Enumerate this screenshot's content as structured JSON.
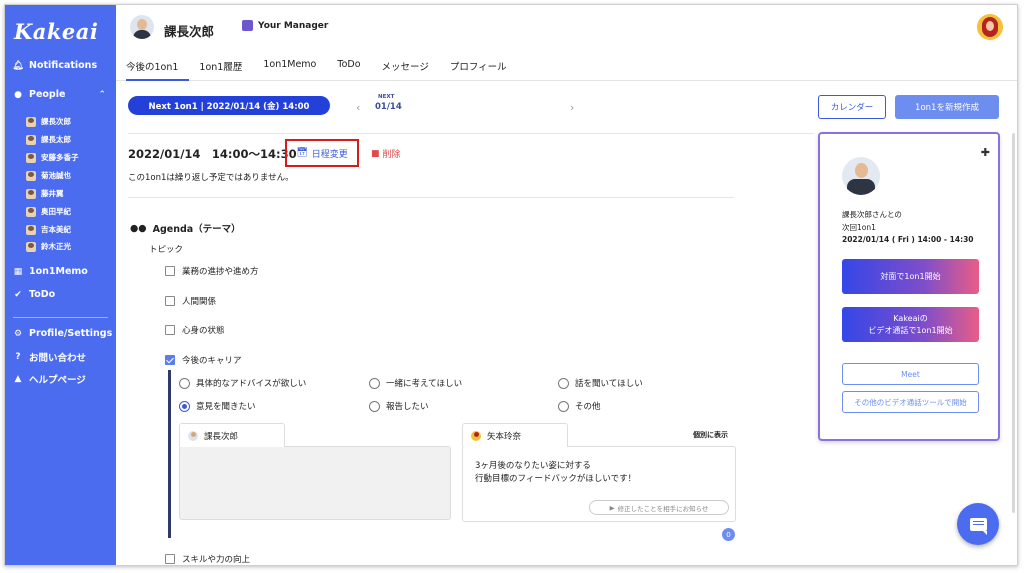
{
  "sidebar": {
    "logo": "Kakeai",
    "nav": {
      "notifications": "Notifications",
      "people": "People",
      "memo": "1on1Memo",
      "todo": "ToDo",
      "profile": "Profile/Settings",
      "contact": "お問い合わせ",
      "help": "ヘルプページ"
    },
    "people": [
      "課長次郎",
      "課長太郎",
      "安藤多香子",
      "菊池誠也",
      "藤井翼",
      "奥田早紀",
      "吉本美紀",
      "鈴木正光"
    ]
  },
  "header": {
    "name": "課長次郎",
    "manager_label": "Your Manager",
    "tabs": [
      "今後の1on1",
      "1on1履歴",
      "1on1Memo",
      "ToDo",
      "メッセージ",
      "プロフィール"
    ]
  },
  "schedule_bar": {
    "next_pill": "Next 1on1 | 2022/01/14 (金) 14:00",
    "next_label": "NEXT",
    "next_date": "01/14",
    "calendar_button": "カレンダー",
    "create_button": "1on1を新規作成"
  },
  "meeting": {
    "datetime": "2022/01/14　14:00〜14:30",
    "reschedule": "日程変更",
    "delete": "削除",
    "repeat_note": "この1on1は繰り返し予定ではありません。"
  },
  "agenda": {
    "title": "Agenda（テーマ）",
    "topic_label": "トピック",
    "topics": [
      "業務の進捗や進め方",
      "人間関係",
      "心身の状態",
      "今後のキャリア",
      "スキルや力の向上"
    ],
    "radio_options": [
      "具体的なアドバイスが欲しい",
      "一緒に考えてほしい",
      "話を聞いてほしい",
      "意見を聞きたい",
      "報告したい",
      "その他"
    ],
    "left_tab": "課長次郎",
    "right_tab": "矢本玲奈",
    "individual": "個別に表示",
    "message_line1": "3ヶ月後のなりたい姿に対する",
    "message_line2": "行動目標のフィードバックがほしいです！",
    "notify_button": "修正したことを相手にお知らせ",
    "badge": "0"
  },
  "card": {
    "line1": "課長次郎さんとの",
    "line2": "次回1on1",
    "line3": "2022/01/14 ( Fri ) 14:00 - 14:30",
    "start_button": "対面で1on1開始",
    "video_line1": "Kakeaiの",
    "video_line2": "ビデオ通話で1on1開始",
    "meet_button": "Meet",
    "other_button": "その他のビデオ通話ツールで開始"
  }
}
